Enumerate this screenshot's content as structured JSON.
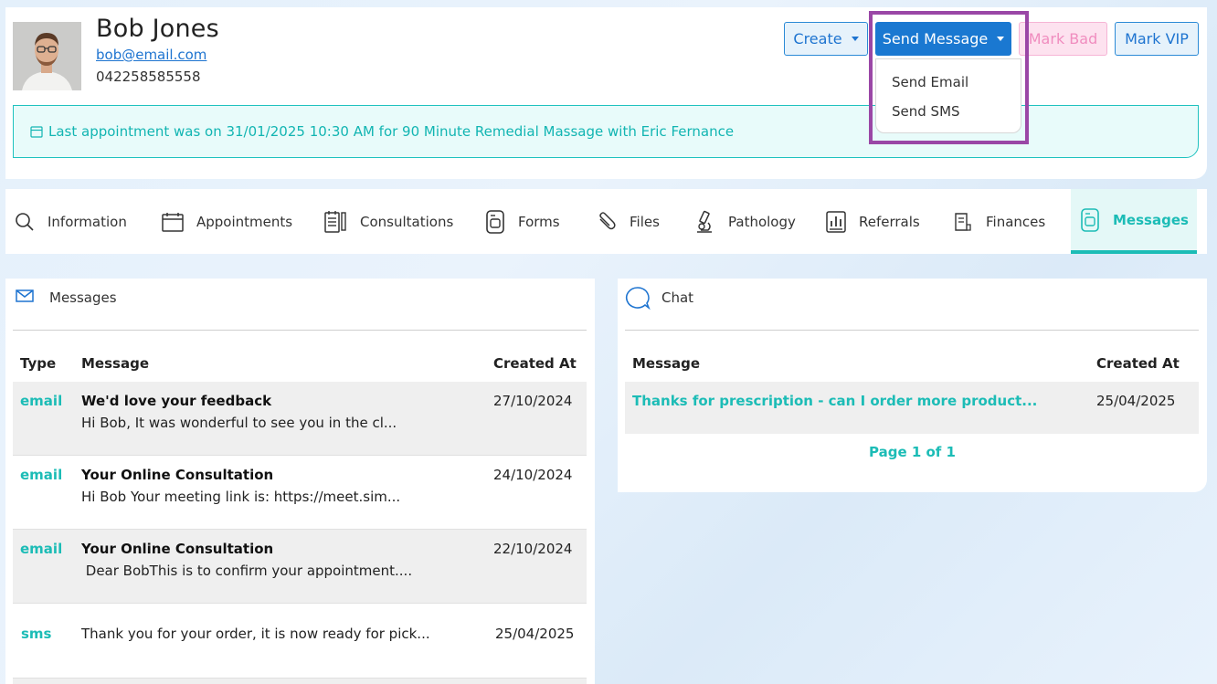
{
  "client": {
    "name": "Bob Jones",
    "email": "bob@email.com",
    "phone": "042258585558"
  },
  "header": {
    "create_label": "Create",
    "send_message_label": "Send Message",
    "mark_bad_label": "Mark Bad",
    "mark_vip_label": "Mark VIP",
    "dropdown": {
      "send_email": "Send Email",
      "send_sms": "Send SMS"
    },
    "last_appointment": "Last appointment was on 31/01/2025 10:30 AM for 90 Minute Remedial Massage with Eric Fernance"
  },
  "tabs": [
    {
      "label": "Information",
      "icon": "search-icon"
    },
    {
      "label": "Appointments",
      "icon": "calendar-icon"
    },
    {
      "label": "Consultations",
      "icon": "notes-icon"
    },
    {
      "label": "Forms",
      "icon": "form-icon"
    },
    {
      "label": "Files",
      "icon": "paperclip-icon"
    },
    {
      "label": "Pathology",
      "icon": "microscope-icon"
    },
    {
      "label": "Referrals",
      "icon": "chart-icon"
    },
    {
      "label": "Finances",
      "icon": "receipt-icon"
    },
    {
      "label": "Messages",
      "icon": "document-icon",
      "active": true
    }
  ],
  "messages_panel": {
    "title": "Messages",
    "columns": {
      "type": "Type",
      "message": "Message",
      "created_at": "Created At"
    },
    "rows": [
      {
        "type": "email",
        "subject": "We'd love your feedback",
        "preview": "Hi Bob, It was wonderful to see you in the cl...",
        "date": "27/10/2024"
      },
      {
        "type": "email",
        "subject": "Your Online Consultation",
        "preview": "Hi Bob Your meeting link is: https://meet.sim...",
        "date": "24/10/2024"
      },
      {
        "type": "email",
        "subject": "Your Online Consultation",
        "preview": " Dear BobThis is to confirm your appointment....",
        "date": "22/10/2024"
      },
      {
        "type": "sms",
        "subject": "",
        "preview": "Thank you for your order, it is now ready for pick...",
        "date": "25/04/2025"
      }
    ]
  },
  "chat_panel": {
    "title": "Chat",
    "columns": {
      "message": "Message",
      "created_at": "Created At"
    },
    "rows": [
      {
        "message": "Thanks for prescription - can I order more product...",
        "date": "25/04/2025"
      }
    ],
    "pager": "Page 1 of 1"
  },
  "colors": {
    "accent": "#1cbcb6",
    "primary": "#1a78d1",
    "highlight": "#9a47a6",
    "danger_soft": "#f08dbf"
  }
}
